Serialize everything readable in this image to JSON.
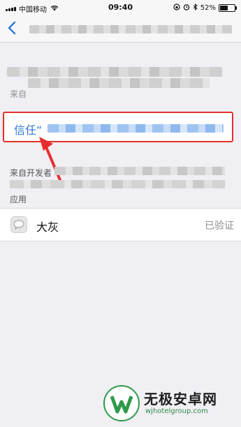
{
  "status_bar": {
    "carrier": "中国移动",
    "time": "09:40",
    "battery": "52%"
  },
  "trust": {
    "label": "信任“"
  },
  "developer": {
    "label": "来自开发者"
  },
  "apps_section": {
    "header": "应用",
    "items": [
      {
        "name": "大灰",
        "status": "已验证"
      }
    ]
  },
  "partial_label": "来自",
  "watermark": {
    "title": "无极安卓网",
    "url": "wjhotelgroup.com"
  },
  "colors": {
    "accent_blue": "#2f7ad6",
    "highlight_red": "#e62e2e",
    "watermark_green": "#2e9a4a"
  }
}
